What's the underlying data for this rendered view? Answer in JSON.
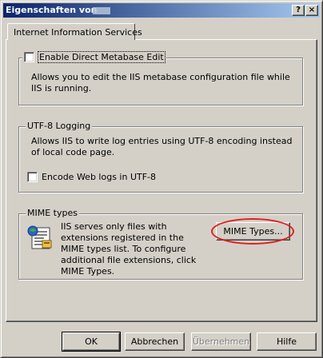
{
  "window": {
    "title": "Eigenschaften von",
    "help_glyph": "?",
    "close_glyph": "×"
  },
  "tabs": [
    {
      "label": "Internet Information Services"
    }
  ],
  "metabase": {
    "checkbox_label": "Enable Direct Metabase Edit",
    "checked": false,
    "description": "Allows you to edit the IIS metabase configuration file while IIS is running."
  },
  "utf8": {
    "group_label": "UTF-8 Logging",
    "description": "Allows IIS to write log entries using UTF-8 encoding instead of local code page.",
    "checkbox_label": "Encode Web logs in UTF-8",
    "checked": false
  },
  "mime": {
    "group_label": "MIME types",
    "description": "IIS serves only files with extensions registered in the MIME types list. To configure additional file extensions, click MIME Types.",
    "button_label": "MIME Types...",
    "icon": "mime-types-icon"
  },
  "footer": {
    "ok": "OK",
    "cancel": "Abbrechen",
    "apply": "Übernehmen",
    "help": "Hilfe"
  },
  "colors": {
    "titlebar_start": "#0a246a",
    "titlebar_end": "#a6caf0",
    "highlight_circle": "#e02020",
    "face": "#d4d0c8"
  }
}
